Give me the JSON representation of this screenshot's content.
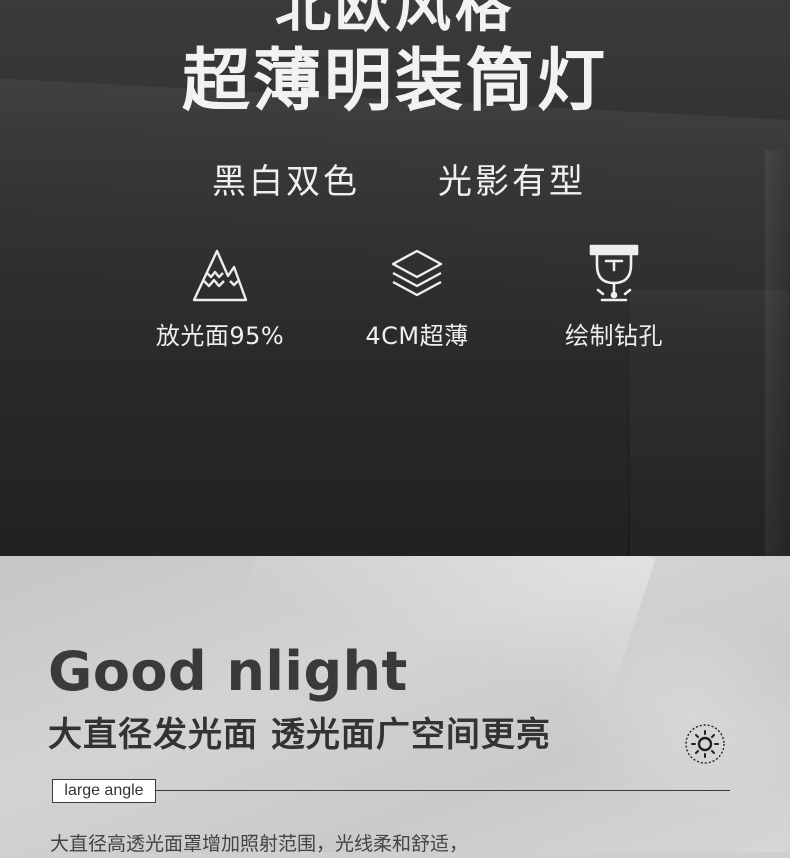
{
  "hero": {
    "title_top": "北欧风格",
    "title_main": "超薄明装筒灯",
    "subtitle_left": "黑白双色",
    "subtitle_right": "光影有型",
    "features": [
      {
        "icon": "mountain-icon",
        "label": "放光面95%"
      },
      {
        "icon": "layers-icon",
        "label": "4CM超薄"
      },
      {
        "icon": "trophy-icon",
        "label": "绘制钻孔"
      }
    ]
  },
  "section": {
    "title_en": "Good nlight",
    "heading_cn": "大直径发光面 透光面广空间更亮",
    "icon": "sun-icon",
    "tag": "large angle",
    "body": "大直径高透光面罩增加照射范围，光线柔和舒适，"
  },
  "colors": {
    "hero_bg": "#2e2e2e",
    "hero_text": "#f2f2f2",
    "lower_bg": "#cfcfcf",
    "lower_text": "#3a3a3a"
  }
}
